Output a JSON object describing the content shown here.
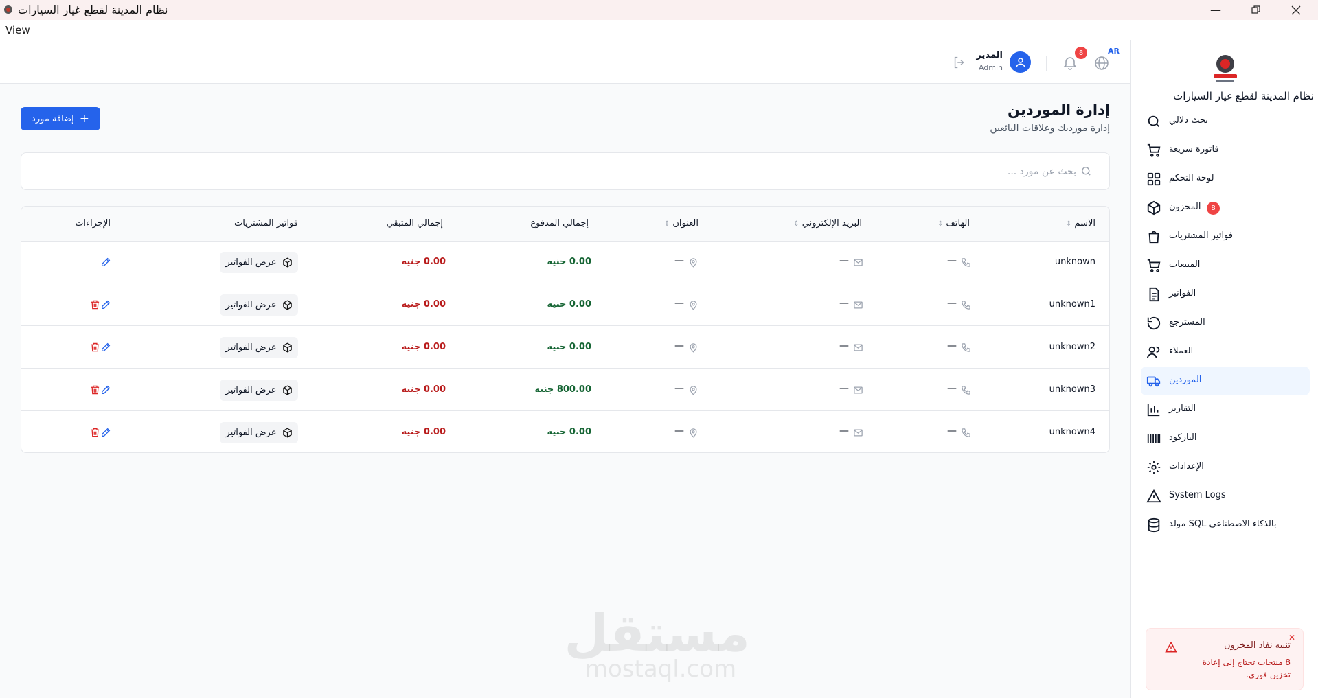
{
  "window": {
    "title": "نظام المدينة لقطع غيار السيارات",
    "menu_view": "View"
  },
  "header": {
    "user_name": "المدير",
    "user_role": "Admin",
    "notifications_count": "8",
    "language": "AR"
  },
  "sidebar": {
    "title": "نظام المدينة لقطع غيار السيارات",
    "items": [
      {
        "label": "بحث دلالي",
        "icon": "search-icon"
      },
      {
        "label": "فاتورة سريعة",
        "icon": "cart-icon"
      },
      {
        "label": "لوحة التحكم",
        "icon": "dashboard-icon"
      },
      {
        "label": "المخزون",
        "icon": "box-icon",
        "badge": "8"
      },
      {
        "label": "فواتير المشتريات",
        "icon": "shopping-bag-icon"
      },
      {
        "label": "المبيعات",
        "icon": "cart-icon"
      },
      {
        "label": "الفواتير",
        "icon": "document-icon"
      },
      {
        "label": "المسترجع",
        "icon": "undo-icon"
      },
      {
        "label": "العملاء",
        "icon": "users-icon"
      },
      {
        "label": "الموردين",
        "icon": "truck-icon",
        "active": true
      },
      {
        "label": "التقارير",
        "icon": "bar-chart-icon"
      },
      {
        "label": "الباركود",
        "icon": "barcode-icon"
      },
      {
        "label": "الإعدادات",
        "icon": "gear-icon"
      },
      {
        "label": "System Logs",
        "icon": "warning-icon"
      },
      {
        "label": "مولد SQL بالذكاء الاصطناعي",
        "icon": "database-icon"
      }
    ]
  },
  "page": {
    "title": "إدارة الموردين",
    "subtitle": "إدارة مورديك وعلاقات البائعين",
    "add_button": "إضافة مورد"
  },
  "search": {
    "placeholder": "بحث عن مورد ..."
  },
  "table": {
    "headers": {
      "name": "الاسم",
      "phone": "الهاتف",
      "email": "البريد الإلكتروني",
      "address": "العنوان",
      "total_paid": "إجمالي المدفوع",
      "total_remaining": "إجمالي المتبقي",
      "purchase_invoices": "فواتير المشتريات",
      "actions": "الإجراءات"
    },
    "empty_value": "—",
    "view_invoices_label": "عرض الفواتير",
    "rows": [
      {
        "name": "unknown",
        "paid": "0.00 جنيه",
        "remaining": "0.00 جنيه"
      },
      {
        "name": "unknown1",
        "paid": "0.00 جنيه",
        "remaining": "0.00 جنيه"
      },
      {
        "name": "unknown2",
        "paid": "0.00 جنيه",
        "remaining": "0.00 جنيه"
      },
      {
        "name": "unknown3",
        "paid": "800.00 جنيه",
        "remaining": "0.00 جنيه"
      },
      {
        "name": "unknown4",
        "paid": "0.00 جنيه",
        "remaining": "0.00 جنيه"
      }
    ]
  },
  "toast": {
    "title": "تنبيه نفاد المخزون",
    "message": "8 منتجات تحتاج إلى إعادة تخزين فوري."
  },
  "watermark": {
    "arabic": "مستقل",
    "latin": "mostaql.com"
  },
  "colors": {
    "primary": "#2563eb",
    "danger": "#dc2626",
    "success": "#166534"
  }
}
